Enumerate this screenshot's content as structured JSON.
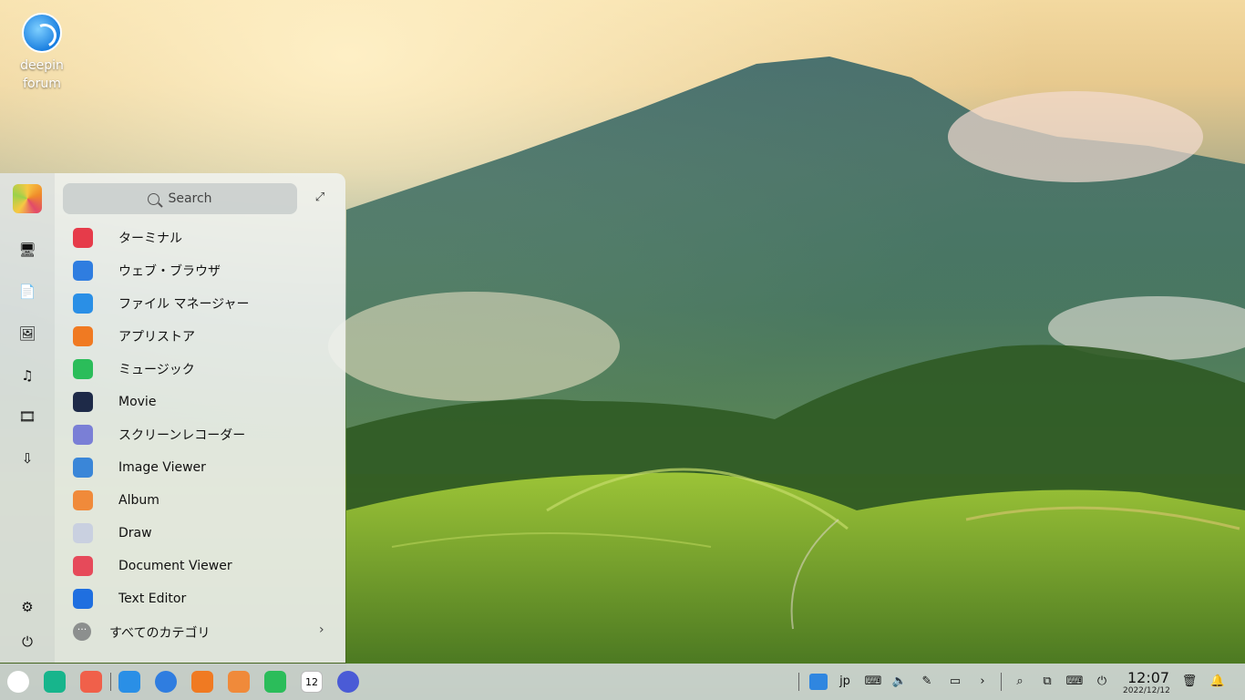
{
  "desktop": {
    "icons": [
      {
        "label_line1": "deepin",
        "label_line2": "forum"
      }
    ]
  },
  "launcher": {
    "search_placeholder": "Search",
    "apps": [
      {
        "name": "ターミナル",
        "icon": "terminal-icon",
        "color": "#e63b4a"
      },
      {
        "name": "ウェブ・ブラウザ",
        "icon": "browser-icon",
        "color": "#2f7de0"
      },
      {
        "name": "ファイル マネージャー",
        "icon": "file-manager-icon",
        "color": "#2a8fe6"
      },
      {
        "name": "アプリストア",
        "icon": "app-store-icon",
        "color": "#f07a22"
      },
      {
        "name": "ミュージック",
        "icon": "music-icon",
        "color": "#2bbd5a"
      },
      {
        "name": "Movie",
        "icon": "movie-icon",
        "color": "#1e2a48"
      },
      {
        "name": "スクリーンレコーダー",
        "icon": "screen-recorder-icon",
        "color": "#7a7fd6"
      },
      {
        "name": "Image Viewer",
        "icon": "image-viewer-icon",
        "color": "#3a86d8"
      },
      {
        "name": "Album",
        "icon": "album-icon",
        "color": "#f08a3a"
      },
      {
        "name": "Draw",
        "icon": "draw-icon",
        "color": "#c9d0e0"
      },
      {
        "name": "Document Viewer",
        "icon": "document-viewer-icon",
        "color": "#e64a5a"
      },
      {
        "name": "Text Editor",
        "icon": "text-editor-icon",
        "color": "#1f6fe0"
      }
    ],
    "categories_label": "すべてのカテゴリ",
    "sidebar": [
      {
        "icon": "computer-icon",
        "glyph": "🖥"
      },
      {
        "icon": "document-icon",
        "glyph": "📄"
      },
      {
        "icon": "picture-icon",
        "glyph": "🖼"
      },
      {
        "icon": "music-note-icon",
        "glyph": "♫"
      },
      {
        "icon": "video-icon",
        "glyph": "🎞"
      },
      {
        "icon": "download-icon",
        "glyph": "⇩"
      },
      {
        "icon": "settings-icon",
        "glyph": "⚙"
      },
      {
        "icon": "power-icon",
        "glyph": "⏻"
      }
    ]
  },
  "dock": {
    "apps": [
      {
        "icon": "launcher-icon",
        "color": "#ffffff"
      },
      {
        "icon": "multitask-view-icon",
        "color": "#17b58c"
      },
      {
        "icon": "workspace-icon",
        "color": "#f0604a"
      },
      {
        "icon": "file-manager-icon",
        "color": "#2a8fe6"
      },
      {
        "icon": "browser-icon",
        "color": "#2f7de0"
      },
      {
        "icon": "app-store-icon",
        "color": "#f07a22"
      },
      {
        "icon": "album-icon",
        "color": "#f08a3a"
      },
      {
        "icon": "music-icon",
        "color": "#2bbd5a"
      },
      {
        "icon": "calendar-icon",
        "color": "#ffffff",
        "text": "12"
      },
      {
        "icon": "control-center-icon",
        "color": "#4a5bd6"
      }
    ],
    "tray": {
      "input_method": "jp",
      "time": "12:07",
      "date": "2022/12/12"
    }
  },
  "colors": {
    "dock_bg": "#d7dcde",
    "launcher_bg": "#f0f2ee",
    "sidebar_bg": "#e1e4e2"
  }
}
